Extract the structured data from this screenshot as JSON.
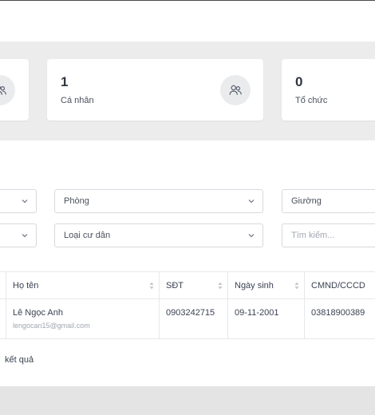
{
  "stats": [
    {
      "value": "",
      "label": "",
      "icon": "users-icon"
    },
    {
      "value": "1",
      "label": "Cá nhân",
      "icon": "users-icon"
    },
    {
      "value": "0",
      "label": "Tổ chức",
      "icon": "users-icon"
    }
  ],
  "filters": {
    "phong": "Phòng",
    "giuong": "Giường",
    "loai_cu_dan": "Loại cư dân",
    "search_placeholder": "Tìm kiếm..."
  },
  "table": {
    "columns": [
      "Họ tên",
      "SĐT",
      "Ngày sinh",
      "CMND/CCCD"
    ],
    "rows": [
      {
        "name": "Lê Ngọc Anh",
        "email": "lengocan15@gmail.com",
        "phone": "0903242715",
        "dob": "09-11-2001",
        "id_number": "03818900389"
      }
    ]
  },
  "footer": {
    "result_text": "kết quả"
  },
  "colors": {
    "accent_icon_bg": "#eaebed",
    "border": "#d6d9de"
  }
}
